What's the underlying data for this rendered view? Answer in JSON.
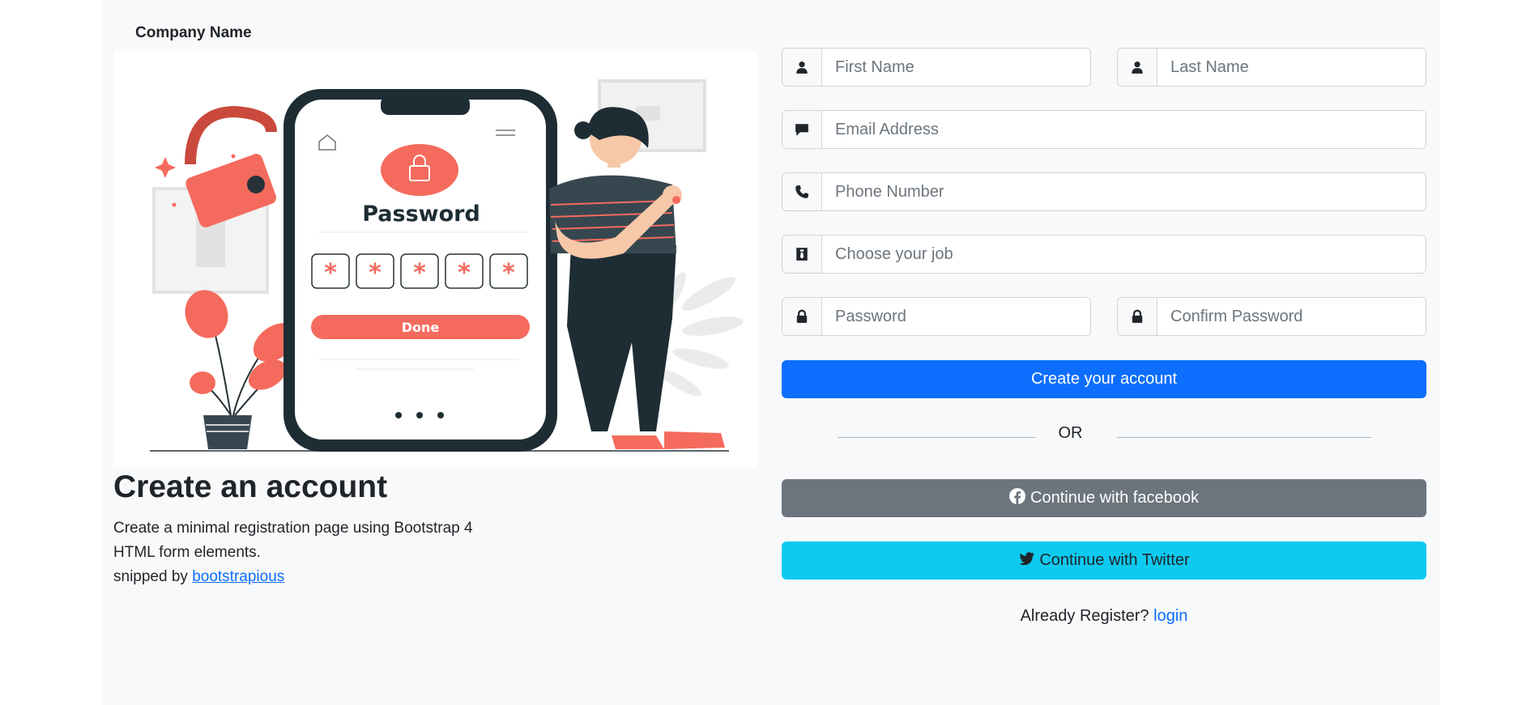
{
  "brand": {
    "company_name": "Company Name"
  },
  "hero": {
    "illustration": "password-phone-illustration",
    "phone_heading": "Password",
    "phone_button": "Done",
    "pin_chars": [
      "*",
      "*",
      "*",
      "*",
      "*"
    ],
    "accent_color": "#f46b5d",
    "dark_color": "#1e2d34"
  },
  "intro": {
    "title": "Create an account",
    "line1": "Create a minimal registration page using Bootstrap 4",
    "line2": "HTML form elements.",
    "credit_prefix": "snipped by ",
    "credit_link": "bootstrapious"
  },
  "form": {
    "first_name": {
      "placeholder": "First Name",
      "icon": "user-icon"
    },
    "last_name": {
      "placeholder": "Last Name",
      "icon": "user-icon"
    },
    "email": {
      "placeholder": "Email Address",
      "icon": "envelope-icon"
    },
    "phone": {
      "placeholder": "Phone Number",
      "icon": "phone-icon"
    },
    "job": {
      "placeholder": "Choose your job",
      "icon": "briefcase-icon"
    },
    "password": {
      "placeholder": "Password",
      "icon": "lock-icon"
    },
    "confirm_password": {
      "placeholder": "Confirm Password",
      "icon": "lock-icon"
    },
    "submit_label": "Create your account",
    "or_label": "OR",
    "facebook_label": "Continue with facebook",
    "twitter_label": "Continue with Twitter",
    "already_text": "Already Register? ",
    "login_link": "login"
  },
  "colors": {
    "primary": "#0d6efd",
    "secondary": "#6c757d",
    "info": "#0dcaf0",
    "background": "#f8f9fa"
  }
}
